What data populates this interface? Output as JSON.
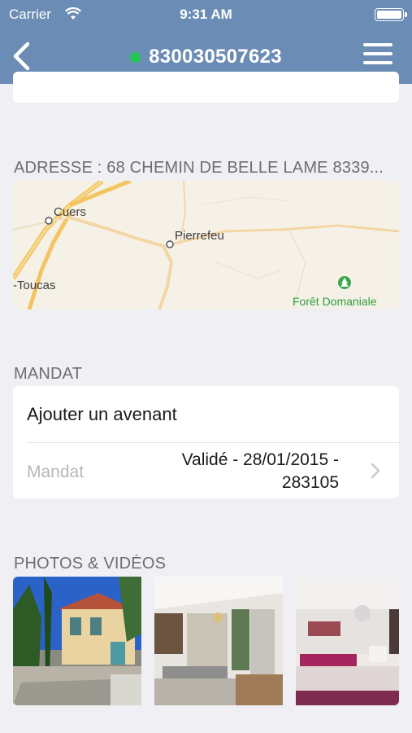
{
  "status_bar": {
    "carrier": "Carrier",
    "time": "9:31 AM"
  },
  "nav": {
    "title": "830030507623",
    "status_color": "#23c552",
    "back_icon": "chevron-left-icon",
    "menu_icon": "hamburger-menu-icon"
  },
  "address": {
    "label": "ADRESSE : 68 CHEMIN DE BELLE LAME 8339...",
    "map_places": {
      "cuers": "Cuers",
      "pierrefeu": "Pierrefeu",
      "toucas": "-Toucas",
      "forest": "Forêt Domaniale"
    }
  },
  "mandat": {
    "label": "MANDAT",
    "add_label": "Ajouter un avenant",
    "row_label": "Mandat",
    "row_value_line1": "Validé - 28/01/2015 -",
    "row_value_line2": "283105"
  },
  "photos": {
    "label": "PHOTOS & VIDÉOS"
  },
  "colors": {
    "nav_bg": "#6b8cb5",
    "background": "#efeff4",
    "accent_green": "#23c552"
  }
}
